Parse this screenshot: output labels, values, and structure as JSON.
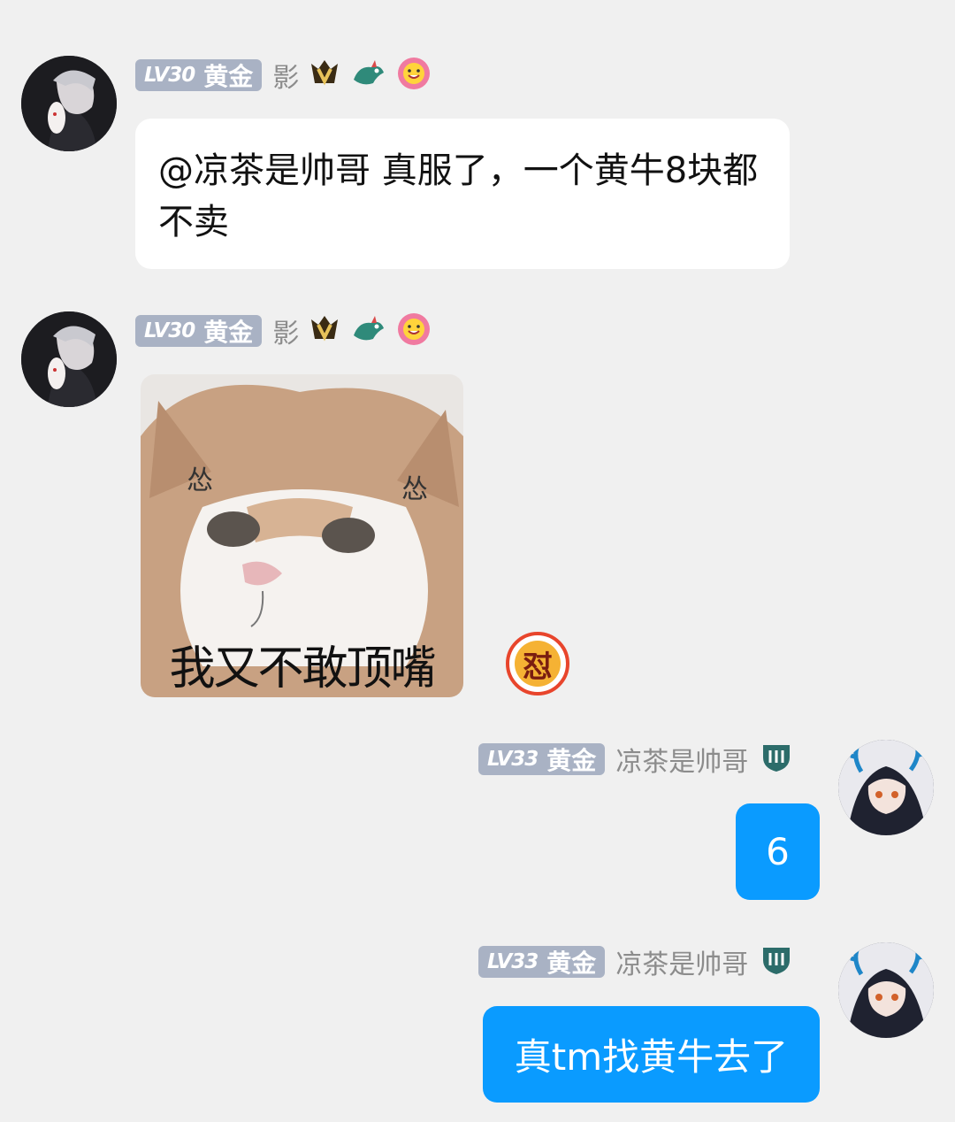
{
  "messages": [
    {
      "sender": {
        "level": "LV30",
        "rank": "黄金",
        "nickname": "影"
      },
      "badges": [
        "crown-v-icon",
        "dragon-icon",
        "smiley-flower-icon"
      ],
      "text": "@凉茶是帅哥 真服了，一个黄牛8块都不卖"
    },
    {
      "sender": {
        "level": "LV30",
        "rank": "黄金",
        "nickname": "影"
      },
      "badges": [
        "crown-v-icon",
        "dragon-icon",
        "smiley-flower-icon"
      ],
      "sticker": {
        "caption": "我又不敢顶嘴",
        "marks": [
          "怂",
          "怂"
        ]
      },
      "reaction": {
        "text": "怼",
        "icon": "reaction-dui-icon"
      }
    },
    {
      "sender": {
        "level": "LV33",
        "rank": "黄金",
        "nickname": "凉茶是帅哥"
      },
      "badges": [
        "shield-iii-icon"
      ],
      "text": "6"
    },
    {
      "sender": {
        "level": "LV33",
        "rank": "黄金",
        "nickname": "凉茶是帅哥"
      },
      "badges": [
        "shield-iii-icon"
      ],
      "text": "真tm找黄牛去了"
    }
  ],
  "colors": {
    "background": "#f0f0f0",
    "self_bubble": "#0a9bff",
    "other_bubble": "#ffffff",
    "level_badge": "#a9b2c4"
  }
}
